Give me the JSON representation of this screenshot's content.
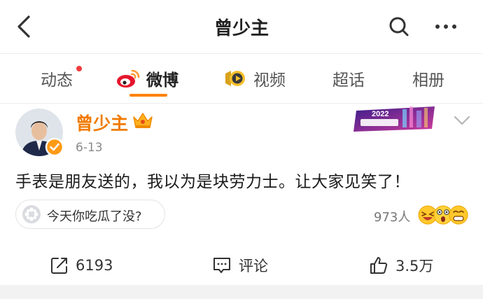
{
  "header": {
    "title": "曾少主",
    "back_icon": "back-arrow-icon",
    "search_icon": "search-icon",
    "more_icon": "more-dots-icon"
  },
  "tabs": [
    {
      "label": "动态",
      "active": false,
      "has_dot": true
    },
    {
      "label": "微博",
      "active": true,
      "icon": "weibo-logo-icon"
    },
    {
      "label": "视频",
      "active": false,
      "icon": "video-icon"
    },
    {
      "label": "超话",
      "active": false
    },
    {
      "label": "相册",
      "active": false
    }
  ],
  "post": {
    "author": "曾少主",
    "date": "6-13",
    "text": "手表是朋友送的，我以为是块劳力士。让大家见笑了！",
    "banner_text": "2022",
    "topic": {
      "label": "今天你吃瓜了没?",
      "icon": "topic-icon"
    },
    "reader_count": "973人"
  },
  "actions": {
    "repost": "6193",
    "comment": "评论",
    "like": "3.5万"
  },
  "colors": {
    "accent": "#ff8200",
    "author_name": "#f07b00",
    "dot": "#f23c3c"
  }
}
